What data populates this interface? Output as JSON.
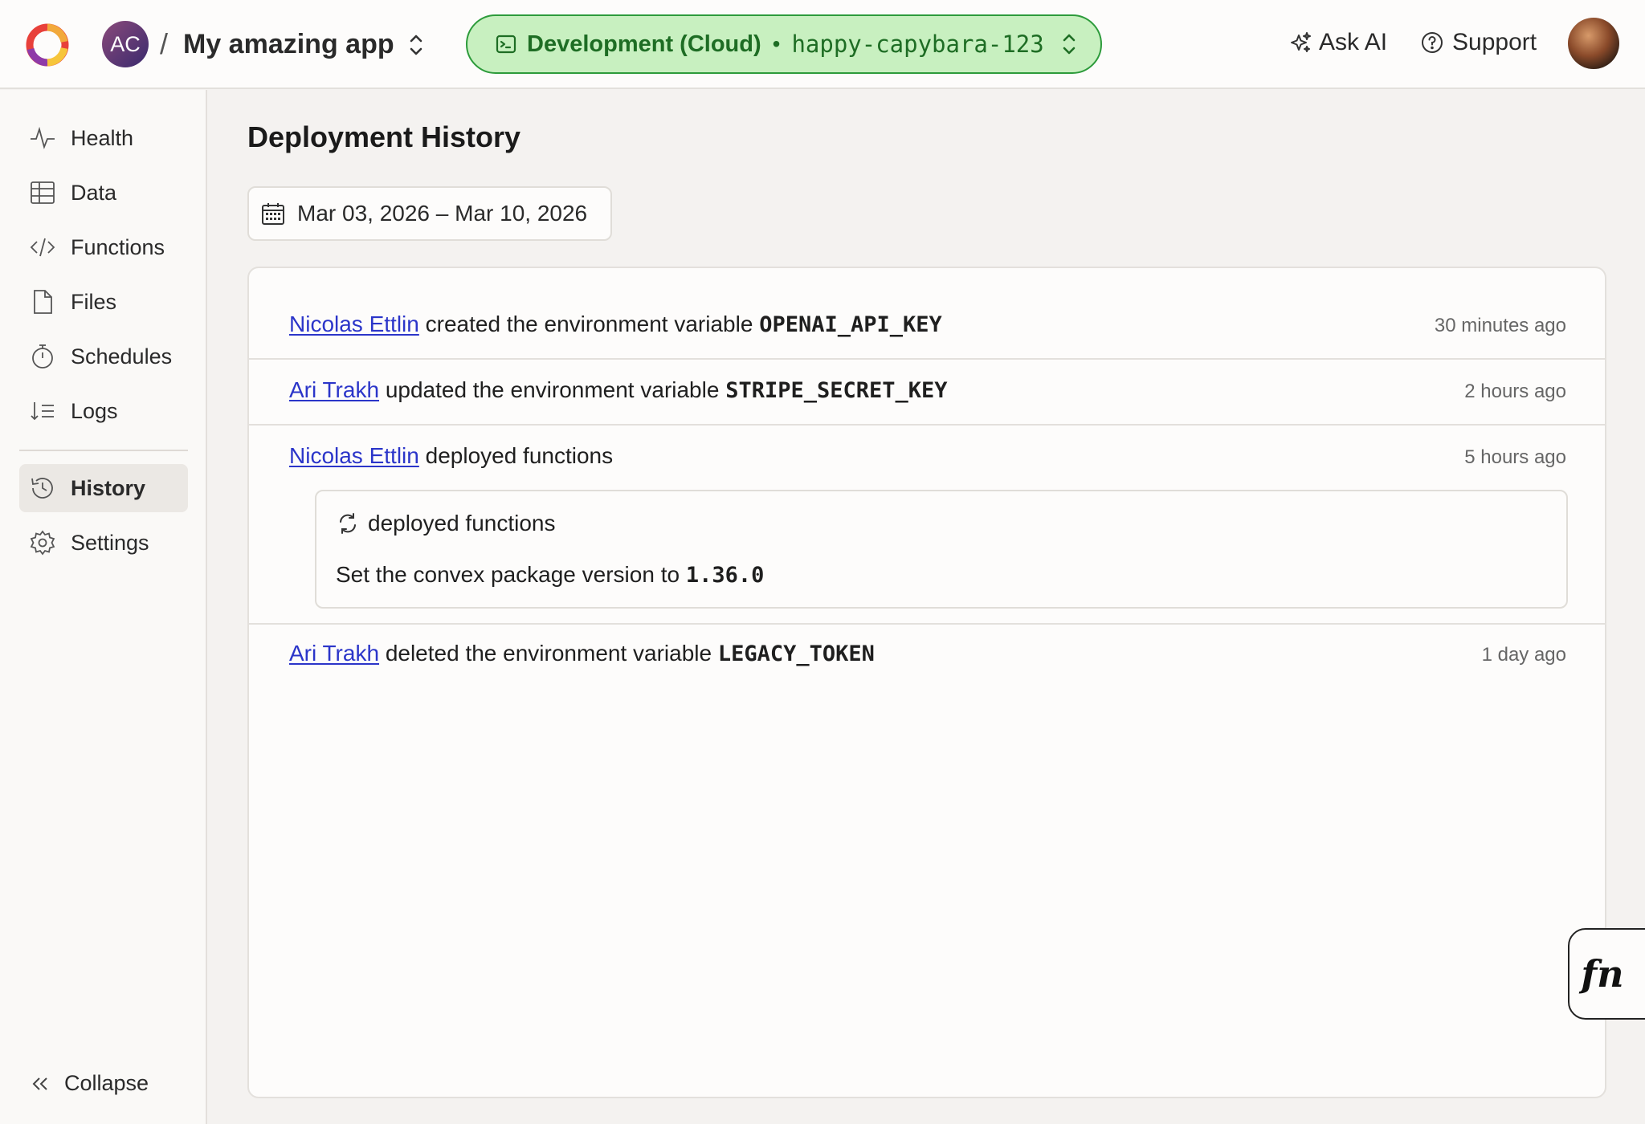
{
  "header": {
    "team_initials": "AC",
    "separator": "/",
    "app_name": "My amazing app",
    "env_label": "Development (Cloud)",
    "env_dot": "•",
    "deployment_slug": "happy-capybara-123",
    "ask_ai_label": "Ask AI",
    "support_label": "Support"
  },
  "sidebar": {
    "items": [
      {
        "label": "Health",
        "icon": "pulse-icon"
      },
      {
        "label": "Data",
        "icon": "table-icon"
      },
      {
        "label": "Functions",
        "icon": "code-icon"
      },
      {
        "label": "Files",
        "icon": "file-icon"
      },
      {
        "label": "Schedules",
        "icon": "stopwatch-icon"
      },
      {
        "label": "Logs",
        "icon": "sort-list-icon"
      },
      {
        "label": "History",
        "icon": "history-icon",
        "active": true
      },
      {
        "label": "Settings",
        "icon": "gear-icon"
      }
    ],
    "collapse_label": "Collapse"
  },
  "main": {
    "title": "Deployment History",
    "date_range": "Mar 03, 2026 – Mar 10, 2026",
    "entries": [
      {
        "user": "Nicolas Ettlin",
        "action": "created the environment variable",
        "target": "OPENAI_API_KEY",
        "time": "30 minutes ago"
      },
      {
        "user": "Ari Trakh",
        "action": "updated the environment variable",
        "target": "STRIPE_SECRET_KEY",
        "time": "2 hours ago"
      },
      {
        "user": "Nicolas Ettlin",
        "action": "deployed functions",
        "target": "",
        "time": "5 hours ago",
        "detail": {
          "title": "deployed functions",
          "text": "Set the convex package version to",
          "version": "1.36.0"
        }
      },
      {
        "user": "Ari Trakh",
        "action": "deleted the environment variable",
        "target": "LEGACY_TOKEN",
        "time": "1 day ago"
      }
    ]
  },
  "fn_button_label": "fn",
  "colors": {
    "env_pill_bg": "#c8f0c0",
    "env_pill_border": "#2d9b3b",
    "link": "#2b35c9",
    "page_bg": "#f4f2f0"
  }
}
